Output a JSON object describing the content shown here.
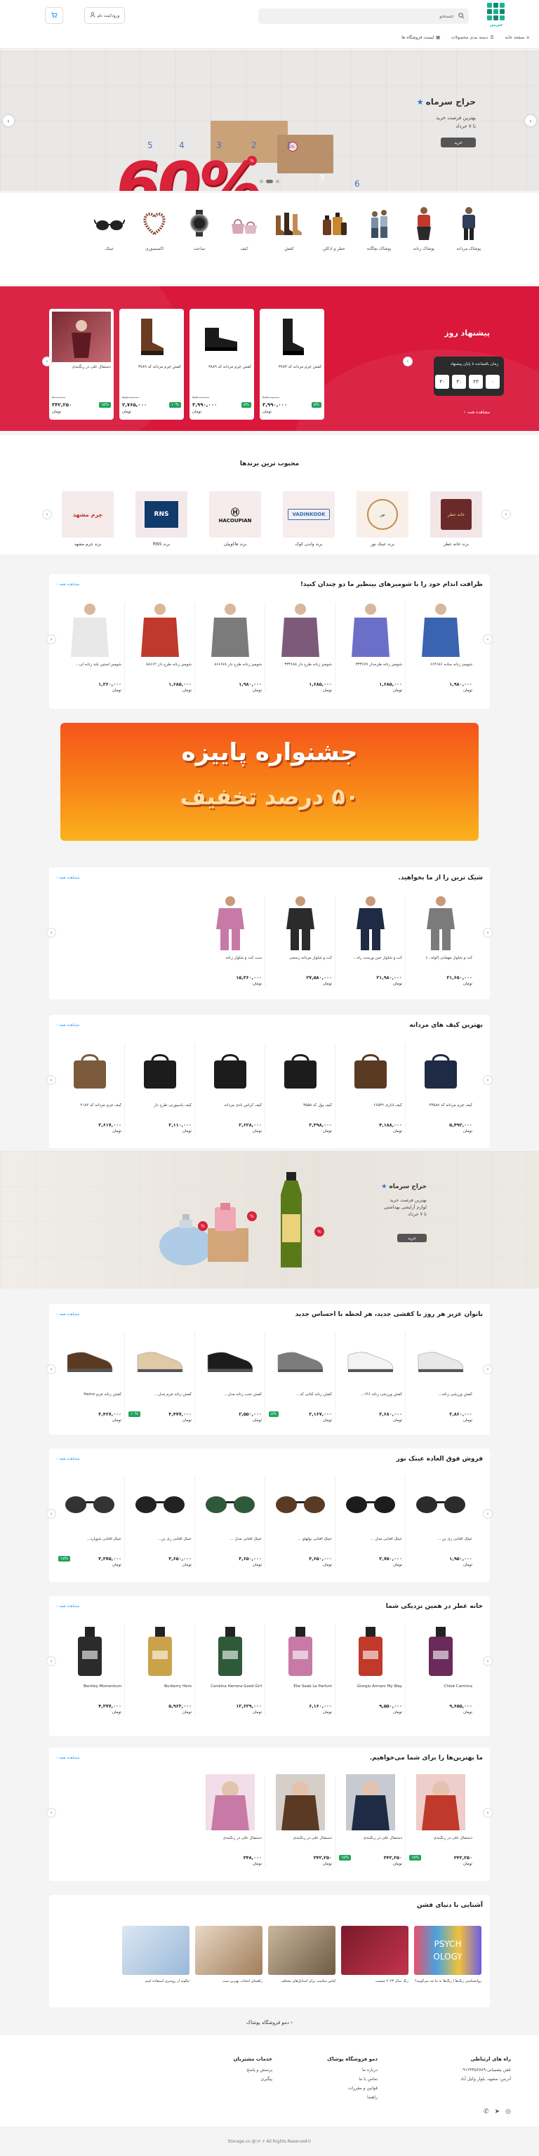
{
  "header": {
    "logo_text": "جی‌پی",
    "search_placeholder": "جستجو",
    "login_label": "ورود/ثبت نام",
    "nav": [
      "صفحه خانه",
      "دسته بندی محصولات",
      "لیست فروشگاه ها"
    ]
  },
  "hero": {
    "title": "حراج سرماه",
    "subtitle": "بهترین فرصت خرید",
    "date": "تا ۷ خرداد",
    "button": "خرید",
    "big_text": "60%",
    "numbers": [
      "1",
      "2",
      "3",
      "4",
      "5",
      "6",
      "7",
      "8"
    ]
  },
  "categories": [
    {
      "label": "پوشاک مردانه",
      "icon": "men-clothing-icon"
    },
    {
      "label": "پوشاک زنانه",
      "icon": "women-clothing-icon"
    },
    {
      "label": "پوشاک بچگانه",
      "icon": "kids-clothing-icon"
    },
    {
      "label": "عطر و ادکلن",
      "icon": "perfume-icon"
    },
    {
      "label": "کفش",
      "icon": "shoes-icon"
    },
    {
      "label": "کیف",
      "icon": "bag-icon"
    },
    {
      "label": "ساعت",
      "icon": "watch-icon"
    },
    {
      "label": "اکسسوری",
      "icon": "accessory-icon"
    },
    {
      "label": "عینک",
      "icon": "glasses-icon"
    }
  ],
  "deals": {
    "title": "پیشنهاد روز",
    "timer_label": "زمان باقیمانده تا پایان پیشنهاد",
    "timer": [
      "۰",
      "۲۳",
      "۳۰",
      "۳۰"
    ],
    "more": "مشاهده همه",
    "cards": [
      {
        "name": "کفش چرم مردانه کد ۳۷۸۳",
        "old": "۴,۲۰۰,۰۰۰",
        "pct": "۵%",
        "price": "۳,۹۹۰,۰۰۰",
        "unit": "تومان"
      },
      {
        "name": "کفش چرم مردانه کد ۳۸۸۹",
        "old": "۴,۲۰۰,۰۰۰",
        "pct": "۵%",
        "price": "۳,۹۹۰,۰۰۰",
        "unit": "تومان"
      },
      {
        "name": "کفش چرم مردانه کد ۳۷۸۹",
        "old": "۲,۸۰۰,۰۰۰",
        "pct": "۱۰%",
        "price": "۲,۷۶۵,۰۰۰",
        "unit": "تومان"
      },
      {
        "name": "دستمال علی در رنگبندی",
        "old": "۴۰۰,۰۰۰",
        "pct": "۱۵%",
        "price": "۳۴۲,۲۵۰",
        "unit": "تومان"
      }
    ]
  },
  "brands": {
    "title": "محبوب ترین برندها",
    "items": [
      {
        "name": "برند خانه عطر",
        "logo": "خانه عطر"
      },
      {
        "name": "برند عینک نور",
        "logo": "نور"
      },
      {
        "name": "برند واندن کوک",
        "logo": "VADINKOOK"
      },
      {
        "name": "برند هاکوپیان",
        "logo": "HACOUPIAN"
      },
      {
        "name": "برند RNS",
        "logo": "RNS"
      },
      {
        "name": "برند چرم مشهد",
        "logo": "چرم مشهد"
      }
    ]
  },
  "s1": {
    "title": "ظرافت اندام خود را با شومیزهای بینظیر ما دو چندان کنید!",
    "more": "مشاهده همه",
    "cards": [
      {
        "name": "شومیز زنانه ساده ۶۶۴۶۸۶",
        "small": "",
        "price": "۱,۹۸۰,۰۰۰",
        "pct": "",
        "old": "",
        "unit": "تومان"
      },
      {
        "name": "شومیز زنانه طرحدار ۳۳۳۶۷۷",
        "small": "",
        "price": "۱,۶۸۵,۰۰۰",
        "pct": "",
        "old": "",
        "unit": "تومان"
      },
      {
        "name": "شومیز زنانه طرح دار ۳۳۳۶۸۸",
        "small": "",
        "price": "۱,۶۸۵,۰۰۰",
        "pct": "",
        "old": "",
        "unit": "تومان"
      },
      {
        "name": "شومیز زنانه طرح دار ۸۶۶۶۷۸",
        "small": "",
        "price": "۱,۹۸۰,۰۰۰",
        "pct": "",
        "old": "",
        "unit": "تومان"
      },
      {
        "name": "شومیز زنانه طرح دار ۸۸۶۶۲",
        "small": "",
        "price": "۱,۶۸۵,۰۰۰",
        "pct": "",
        "old": "",
        "unit": "تومان"
      },
      {
        "name": "شومیز آستین بلند زنانه لی...",
        "small": "",
        "price": "۱,۲۶۰,۰۰۰",
        "pct": "",
        "old": "",
        "unit": "تومان"
      }
    ]
  },
  "autumn": {
    "line1": "جشنواره پاییزه",
    "line2": "۵۰ درصد تخفیف"
  },
  "s2": {
    "title": "شیک ترین را از ما بخواهید.",
    "more": "مشاهده همه",
    "cards": [
      {
        "name": "کت و شلوار مهمانی (لوله...)",
        "small": "",
        "price": "۲۱,۶۵۰,۰۰۰",
        "unit": "تومان"
      },
      {
        "name": "کت و شلوار جین ورست راه...",
        "small": "",
        "price": "۲۱,۹۸۰,۰۰۰",
        "unit": "تومان"
      },
      {
        "name": "کت و شلوار مردانه رسمی",
        "small": "",
        "price": "۲۷,۵۸۰,۰۰۰",
        "unit": "تومان"
      },
      {
        "name": "ست کت و شلوار زنانه",
        "small": "",
        "price": "۱۵,۳۶۰,۰۰۰",
        "unit": "تومان"
      }
    ]
  },
  "s3": {
    "title": "بهترین کیف های مردانه",
    "more": "مشاهده همه",
    "cards": [
      {
        "name": "کیف چرم مردانه کد ۴۳۵۸۸",
        "small": "",
        "price": "۵,۴۹۲,۰۰۰",
        "unit": "تومان"
      },
      {
        "name": "کیف اداری ۶۶۵۳۲",
        "small": "",
        "price": "۴,۱۸۸,۰۰۰",
        "unit": "تومان"
      },
      {
        "name": "کیف پول کد ۳۵۵۵",
        "small": "",
        "price": "۲,۳۹۸,۰۰۰",
        "unit": "تومان"
      },
      {
        "name": "کیف کراس بادی مردانه",
        "small": "",
        "price": "۲,۶۲۸,۰۰۰",
        "unit": "تومان"
      },
      {
        "name": "کیف پاسپورتی طرح دار",
        "small": "",
        "price": "۲,۱۱۰,۰۰۰",
        "unit": "تومان"
      },
      {
        "name": "کیف چرم مردانه کد ۲۱۸۲",
        "small": "",
        "price": "۲,۶۱۷,۰۰۰",
        "unit": "تومان"
      }
    ]
  },
  "banner2": {
    "title": "حراج سرماه",
    "sub1": "بهترین فرصت خرید",
    "sub2": "لوازم آرایشی بهداشتی",
    "sub3": "تا ۷ خرداد",
    "button": "خرید"
  },
  "s4": {
    "title": "بانوان عزیز هر روز با کفشی جدید، هر لحظه با احساس جدید",
    "more": "مشاهده همه",
    "cards": [
      {
        "name": "کفش ورزشی زنانه...",
        "small": "",
        "price": "۲,۸۶۰,۰۰۰",
        "pct": "",
        "old": "",
        "unit": "تومان"
      },
      {
        "name": "کفش ورزشی زنانه ۱۴۶...",
        "small": "",
        "price": "۳,۶۸۰,۰۰۰",
        "pct": "",
        "old": "",
        "unit": "تومان"
      },
      {
        "name": "کفش زنانه کتانی کد...",
        "small": "",
        "price": "۲,۱۶۷,۰۰۰",
        "pct": "۵%",
        "old": "",
        "unit": "تومان"
      },
      {
        "name": "کفش تخت زنانه مدل...",
        "small": "",
        "price": "۲,۵۵۰,۰۰۰",
        "pct": "",
        "old": "",
        "unit": "تومان"
      },
      {
        "name": "کفش زنانه چرم مدل...",
        "small": "",
        "price": "۳,۴۷۷,۰۰۰",
        "pct": "۱۰%",
        "old": "",
        "unit": "تومان"
      },
      {
        "name": "کفش زنانه چرم Heino",
        "small": "",
        "price": "۳,۴۶۷,۰۰۰",
        "pct": "",
        "old": "",
        "unit": "تومان"
      }
    ]
  },
  "s5": {
    "title": "فروش فوق العاده عینک نور",
    "more": "مشاهده همه",
    "cards": [
      {
        "name": "عینک آفتابی ری بن ...",
        "small": "",
        "price": "۱,۹۵۰,۰۰۰",
        "pct": "",
        "old": "",
        "unit": "تومان"
      },
      {
        "name": "عینک آفتابی مدل ...",
        "small": "",
        "price": "۳,۷۵۰,۰۰۰",
        "pct": "",
        "old": "",
        "unit": "تومان"
      },
      {
        "name": "عینک آفتابی بولهلو ...",
        "small": "",
        "price": "۳,۶۵۰,۰۰۰",
        "pct": "",
        "old": "",
        "unit": "تومان"
      },
      {
        "name": "عینک آفتابی مدل ...",
        "small": "",
        "price": "۳,۶۵۰,۰۰۰",
        "pct": "",
        "old": "",
        "unit": "تومان"
      },
      {
        "name": "عینک آفتابی ری بن...",
        "small": "",
        "price": "۳,۶۵۰,۰۰۰",
        "pct": "",
        "old": "",
        "unit": "تومان"
      },
      {
        "name": "عینک آفتابی شوپارد...",
        "small": "",
        "price": "۳,۳۷۵,۰۰۰",
        "pct": "۱۵%",
        "old": "",
        "unit": "تومان"
      }
    ]
  },
  "s6": {
    "title": "خانه عطر در همین نزدیکی شما",
    "more": "مشاهده همه",
    "cards": [
      {
        "name": "Chloé Carmina",
        "small": "",
        "price": "۹,۶۵۵,۰۰۰",
        "pct": "",
        "old": "",
        "unit": "تومان"
      },
      {
        "name": "Giorgio Armani My Way",
        "small": "",
        "price": "۹,۵۵۰,۰۰۰",
        "pct": "",
        "old": "",
        "unit": "تومان"
      },
      {
        "name": "Elie Saab Le Parfum",
        "small": "",
        "price": "۶,۱۶۰,۰۰۰",
        "pct": "",
        "old": "",
        "unit": "تومان"
      },
      {
        "name": "Carolina Herrera Good Girl",
        "small": "",
        "price": "۱۲,۶۲۹,۰۰۰",
        "pct": "",
        "old": "",
        "unit": "تومان"
      },
      {
        "name": "Burberry Hero",
        "small": "",
        "price": "۵,۹۶۳,۰۰۰",
        "pct": "",
        "old": "",
        "unit": "تومان"
      },
      {
        "name": "Bentley Momentum",
        "small": "",
        "price": "۴,۳۷۷,۰۰۰",
        "pct": "",
        "old": "",
        "unit": "تومان"
      }
    ]
  },
  "s7": {
    "title": "ما بهترین‌ها را برای شما می‌خواهیم.",
    "more": "مشاهده همه",
    "cards": [
      {
        "name": "دستمال علی در رنگبندی",
        "small": "",
        "price": "۳۴۲,۲۵۰",
        "pct": "۱۵%",
        "old": "",
        "unit": "تومان"
      },
      {
        "name": "دستمال علی در رنگبندی",
        "small": "",
        "price": "۳۴۲,۲۵۰",
        "pct": "۱۵%",
        "old": "",
        "unit": "تومان"
      },
      {
        "name": "دستمال علی در رنگبندی",
        "small": "",
        "price": "۳۴۲,۲۵۰",
        "pct": "",
        "old": "",
        "unit": "تومان"
      },
      {
        "name": "دستمال علی در رنگبندی",
        "small": "",
        "price": "۳۴۸,۰۰۰",
        "pct": "",
        "old": "",
        "unit": "تومان"
      }
    ]
  },
  "s8": {
    "title": "آشنایی با دنیای فشن",
    "cards": [
      {
        "text": "روانشناسی رنگ‌ها | رنگ‌ها به ما چه می‌گویند؟"
      },
      {
        "text": "رنگ سال ۲۰۲۳ چیست"
      },
      {
        "text": "لباس مناسب برای استایل‌های مختلف"
      },
      {
        "text": "راهنمای انتخاب بهترین ست"
      },
      {
        "text": "چگونه از روسری استفاده کنیم"
      }
    ]
  },
  "footer": {
    "shop_link": "دمو فروشگاه پوشاک",
    "col1_title": "راه های ارتباطی",
    "col1": [
      "تلفن پشتیبانی:۰۹۱۲۳۴۵۶۷۸۹",
      "آدرس: مشهد، بلوار وکیل آباد"
    ],
    "col2_title": "دمو فروشگاه پوشاک",
    "col2": [
      "درباره ما",
      "تماس با ما",
      "قوانین و مقررات",
      "راهنما"
    ],
    "col3_title": "خدمات مشتریان",
    "col3": [
      "پرسش و پاسخ",
      "پیگیری"
    ],
    "copyright": "©Storage.co @۱۴۰۲ All Rights Reserved"
  },
  "colors": {
    "accent": "#1ab394",
    "red": "#d9183b",
    "green": "#20a35a",
    "link": "#3399ff"
  }
}
